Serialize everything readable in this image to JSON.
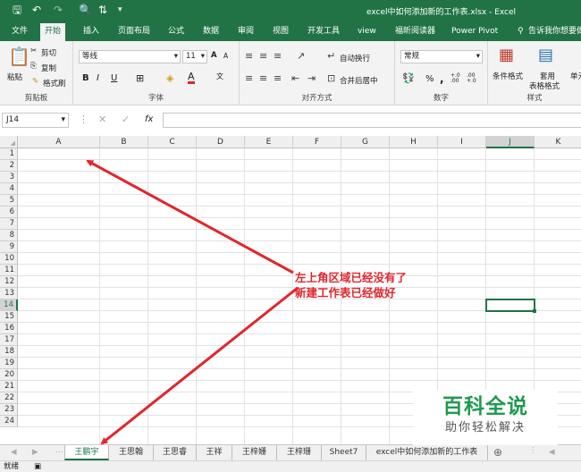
{
  "window": {
    "title": "excel中如何添加新的工作表.xlsx  -  Excel"
  },
  "quick_access": [
    "save-icon",
    "undo-icon",
    "redo-icon",
    "print-preview-icon",
    "sort-icon"
  ],
  "ribbon_tabs": [
    "文件",
    "开始",
    "插入",
    "页面布局",
    "公式",
    "数据",
    "审阅",
    "视图",
    "开发工具",
    "view",
    "福昕阅读器",
    "Power Pivot"
  ],
  "tell_me": "告诉我你想要做",
  "clipboard": {
    "paste": "粘贴",
    "cut": "剪切",
    "copy": "复制",
    "format_painter": "格式刷",
    "label": "剪贴板"
  },
  "font": {
    "name": "等线",
    "size": "11",
    "bold": "B",
    "italic": "I",
    "underline": "U",
    "grow": "A",
    "shrink": "A",
    "label": "字体"
  },
  "alignment": {
    "wrap": "自动换行",
    "merge": "合并后居中",
    "label": "对齐方式"
  },
  "number": {
    "format": "常规",
    "percent": "%",
    "comma": ",",
    "inc_decimal": "+.0 .00",
    "dec_decimal": ".00 +.0",
    "label": "数字"
  },
  "styles": {
    "cond_format": "条件格式",
    "table_format_1": "套用",
    "table_format_2": "表格格式",
    "cell_styles": "单元",
    "label": "样式"
  },
  "formula_bar": {
    "name_box": "J14",
    "fx": "fx"
  },
  "columns": [
    "A",
    "B",
    "C",
    "D",
    "E",
    "F",
    "G",
    "H",
    "I",
    "J",
    "K"
  ],
  "rows": [
    "1",
    "2",
    "3",
    "4",
    "5",
    "6",
    "7",
    "8",
    "9",
    "10",
    "11",
    "12",
    "13",
    "14",
    "15",
    "16",
    "17",
    "18",
    "19",
    "20",
    "21",
    "22",
    "23",
    "24"
  ],
  "selected_cell": "J14",
  "annotation": {
    "line1": "左上角区域已经没有了",
    "line2": "新建工作表已经做好"
  },
  "sheet_tabs": [
    "王鹏宇",
    "王思翰",
    "王思睿",
    "王祥",
    "王梓姗",
    "王梓珊",
    "Sheet7",
    "excel中如何添加新的工作表"
  ],
  "active_sheet": "王鹏宇",
  "status": {
    "ready": "就绪"
  },
  "watermark": {
    "title": "百科全说",
    "subtitle": "助你轻松解决"
  },
  "colors": {
    "accent": "#217346",
    "annotation": "#e0262e",
    "watermark": "#1f9a4f"
  }
}
